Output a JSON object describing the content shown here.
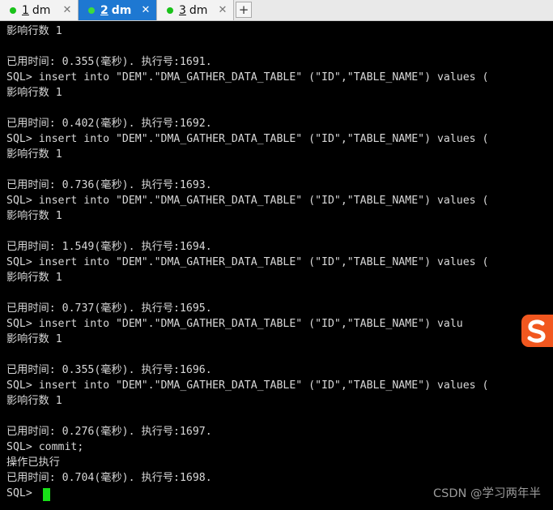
{
  "tabs": [
    {
      "number": "1",
      "name": "dm",
      "close": "✕",
      "active": false
    },
    {
      "number": "2",
      "name": "dm",
      "close": "✕",
      "active": true
    },
    {
      "number": "3",
      "name": "dm",
      "close": "✕",
      "active": false
    }
  ],
  "new_tab_label": "+",
  "terminal_lines": [
    "影响行数 1",
    "",
    "已用时间: 0.355(毫秒). 执行号:1691.",
    "SQL> insert into \"DEM\".\"DMA_GATHER_DATA_TABLE\" (\"ID\",\"TABLE_NAME\") values (",
    "影响行数 1",
    "",
    "已用时间: 0.402(毫秒). 执行号:1692.",
    "SQL> insert into \"DEM\".\"DMA_GATHER_DATA_TABLE\" (\"ID\",\"TABLE_NAME\") values (",
    "影响行数 1",
    "",
    "已用时间: 0.736(毫秒). 执行号:1693.",
    "SQL> insert into \"DEM\".\"DMA_GATHER_DATA_TABLE\" (\"ID\",\"TABLE_NAME\") values (",
    "影响行数 1",
    "",
    "已用时间: 1.549(毫秒). 执行号:1694.",
    "SQL> insert into \"DEM\".\"DMA_GATHER_DATA_TABLE\" (\"ID\",\"TABLE_NAME\") values (",
    "影响行数 1",
    "",
    "已用时间: 0.737(毫秒). 执行号:1695.",
    "SQL> insert into \"DEM\".\"DMA_GATHER_DATA_TABLE\" (\"ID\",\"TABLE_NAME\") valu",
    "影响行数 1",
    "",
    "已用时间: 0.355(毫秒). 执行号:1696.",
    "SQL> insert into \"DEM\".\"DMA_GATHER_DATA_TABLE\" (\"ID\",\"TABLE_NAME\") values (",
    "影响行数 1",
    "",
    "已用时间: 0.276(毫秒). 执行号:1697.",
    "SQL> commit;",
    "操作已执行",
    "已用时间: 0.704(毫秒). 执行号:1698.",
    "SQL> "
  ],
  "colors": {
    "active_tab": "#1e78d2",
    "status_dot": "#19c219",
    "cursor": "#18e018",
    "ime_badge": "#f1571f"
  },
  "ime_icon": "sogou-s-icon",
  "watermark": "CSDN @学习两年半"
}
